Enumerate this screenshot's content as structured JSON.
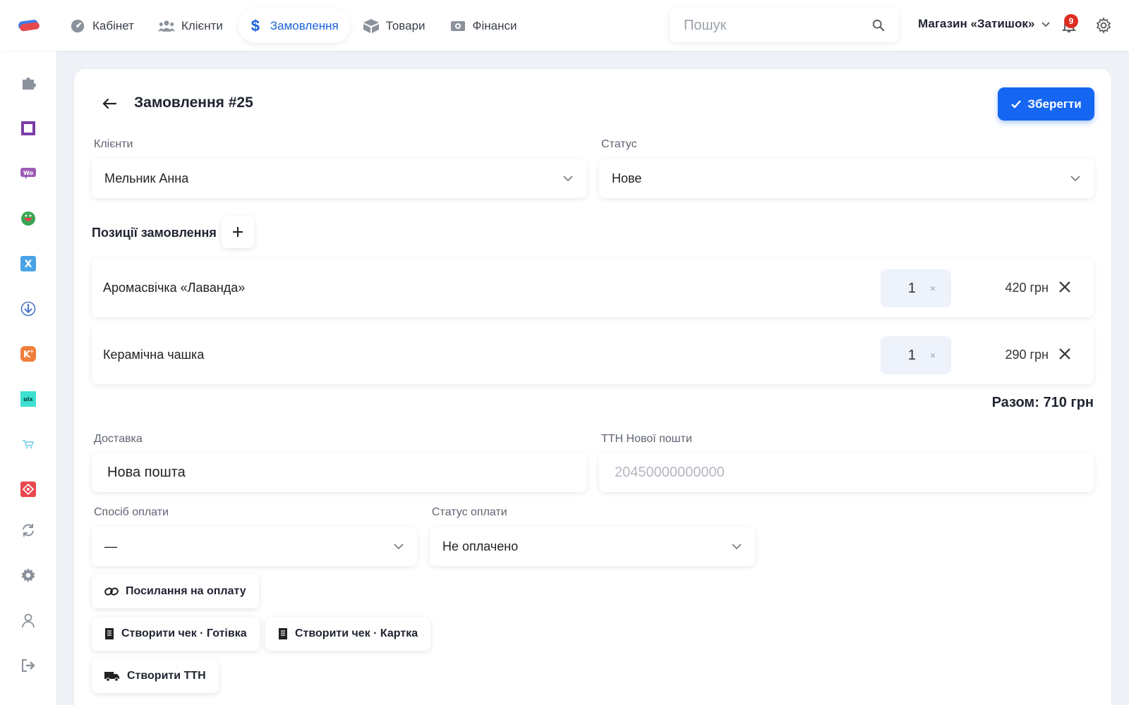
{
  "topbar": {
    "nav": [
      {
        "label": "Кабінет",
        "icon": "dashboard-icon"
      },
      {
        "label": "Клієнти",
        "icon": "users-icon"
      },
      {
        "label": "Замовлення",
        "icon": "dollar-icon"
      },
      {
        "label": "Товари",
        "icon": "box-icon"
      },
      {
        "label": "Фінанси",
        "icon": "money-icon"
      }
    ],
    "active_nav": "Замовлення",
    "search_placeholder": "Пошук",
    "store_name": "Магазин «Затишок»",
    "notifications_count": "9"
  },
  "sidebar": {
    "items": [
      "puzzle-icon",
      "square-icon",
      "woo-icon",
      "smile-icon",
      "x-icon",
      "download-icon",
      "k-plus-icon",
      "olx-icon",
      "cart-icon",
      "diamond-icon",
      "sync-icon",
      "gear-icon",
      "user-icon",
      "logout-icon"
    ]
  },
  "order": {
    "title": "Замовлення #25",
    "save_label": "Зберегти",
    "client_label": "Клієнти",
    "client_value": "Мельник Анна",
    "status_label": "Статус",
    "status_value": "Нове",
    "positions_title": "Позиції замовлення",
    "items": [
      {
        "name": "Аромасвічка «Лаванда»",
        "qty": "1",
        "price": "420 грн"
      },
      {
        "name": "Керамічна чашка",
        "qty": "1",
        "price": "290 грн"
      }
    ],
    "total": "Разом: 710 грн",
    "delivery_label": "Доставка",
    "delivery_value": "Нова пошта",
    "ttn_label": "ТТН Нової пошти",
    "ttn_placeholder": "20450000000000",
    "payment_method_label": "Спосіб оплати",
    "payment_method_value": "—",
    "payment_status_label": "Статус оплати",
    "payment_status_value": "Не оплачено",
    "payment_link_label": "Посилання на оплату",
    "receipt_cash_label": "Створити чек · Готівка",
    "receipt_card_label": "Створити чек · Картка",
    "create_ttn_label": "Створити ТТН"
  },
  "colors": {
    "accent": "#1566f2",
    "active_nav": "#1a62d6",
    "badge": "#e02b20"
  }
}
